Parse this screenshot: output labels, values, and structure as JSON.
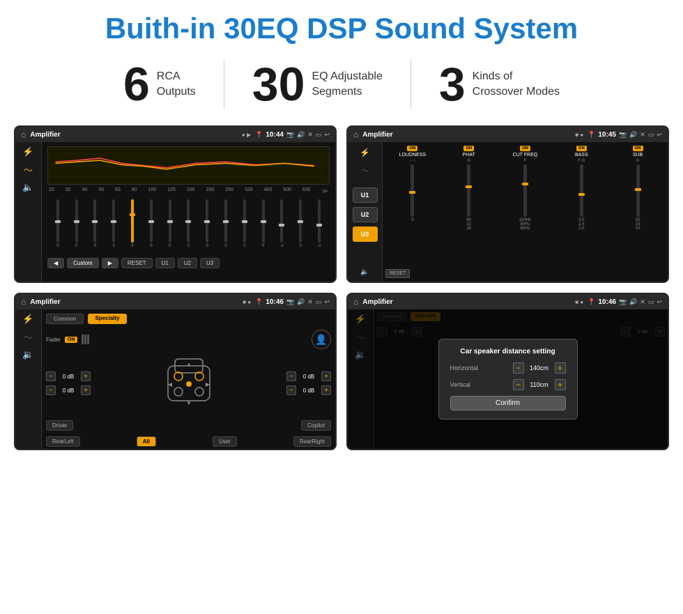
{
  "page": {
    "title": "Buith-in 30EQ DSP Sound System",
    "background": "#ffffff"
  },
  "stats": [
    {
      "number": "6",
      "label_line1": "RCA",
      "label_line2": "Outputs"
    },
    {
      "number": "30",
      "label_line1": "EQ Adjustable",
      "label_line2": "Segments"
    },
    {
      "number": "3",
      "label_line1": "Kinds of",
      "label_line2": "Crossover Modes"
    }
  ],
  "screens": [
    {
      "id": "screen1",
      "title": "Amplifier",
      "time": "10:44",
      "type": "eq"
    },
    {
      "id": "screen2",
      "title": "Amplifier",
      "time": "10:45",
      "type": "crossover"
    },
    {
      "id": "screen3",
      "title": "Amplifier",
      "time": "10:46",
      "type": "speaker"
    },
    {
      "id": "screen4",
      "title": "Amplifier",
      "time": "10:46",
      "type": "dialog"
    }
  ],
  "eq_screen": {
    "frequencies": [
      "25",
      "32",
      "40",
      "50",
      "63",
      "80",
      "100",
      "125",
      "160",
      "200",
      "250",
      "320",
      "400",
      "500",
      "630"
    ],
    "values": [
      "0",
      "0",
      "0",
      "0",
      "5",
      "0",
      "0",
      "0",
      "0",
      "0",
      "0",
      "0",
      "-1",
      "0",
      "-1"
    ],
    "buttons": [
      "Custom",
      "RESET",
      "U1",
      "U2",
      "U3"
    ]
  },
  "crossover_screen": {
    "u_buttons": [
      "U1",
      "U2",
      "U3"
    ],
    "u_active": 2,
    "channels": [
      {
        "name": "LOUDNESS",
        "on": true
      },
      {
        "name": "PHAT",
        "on": true
      },
      {
        "name": "CUT FREQ",
        "on": true
      },
      {
        "name": "BASS",
        "on": true
      },
      {
        "name": "SUB",
        "on": true
      }
    ],
    "reset_label": "RESET"
  },
  "speaker_screen": {
    "tabs": [
      "Common",
      "Specialty"
    ],
    "active_tab": 1,
    "fader_label": "Fader",
    "fader_on": true,
    "db_values": [
      "0 dB",
      "0 dB",
      "0 dB",
      "0 dB"
    ],
    "bottom_buttons": [
      "Driver",
      "",
      "Copilot",
      "RearLeft",
      "All",
      "User",
      "RearRight"
    ]
  },
  "dialog_screen": {
    "title": "Car speaker distance setting",
    "horizontal_label": "Horizontal",
    "horizontal_value": "140cm",
    "vertical_label": "Vertical",
    "vertical_value": "110cm",
    "confirm_label": "Confirm",
    "tabs": [
      "Common",
      "Specialty"
    ]
  }
}
